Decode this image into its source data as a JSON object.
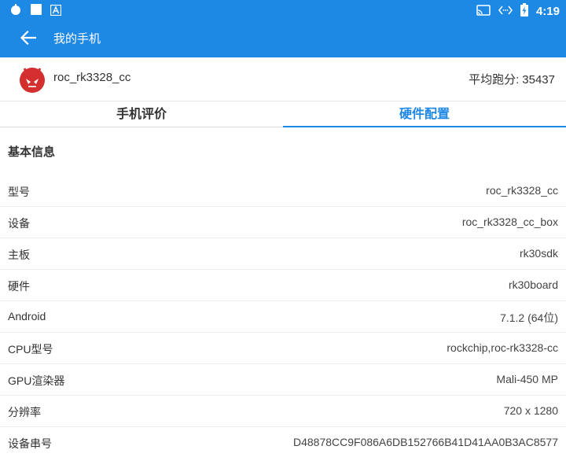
{
  "statusbar": {
    "time": "4:19"
  },
  "appbar": {
    "title": "我的手机"
  },
  "device": {
    "name": "roc_rk3328_cc",
    "score_label": "平均跑分:",
    "score_value": "35437"
  },
  "tabs": [
    {
      "label": "手机评价",
      "active": false
    },
    {
      "label": "硬件配置",
      "active": true
    }
  ],
  "section": {
    "title": "基本信息"
  },
  "info_rows": [
    {
      "label": "型号",
      "value": "roc_rk3328_cc"
    },
    {
      "label": "设备",
      "value": "roc_rk3328_cc_box"
    },
    {
      "label": "主板",
      "value": "rk30sdk"
    },
    {
      "label": "硬件",
      "value": "rk30board"
    },
    {
      "label": "Android",
      "value": "7.1.2 (64位)"
    },
    {
      "label": "CPU型号",
      "value": "rockchip,roc-rk3328-cc"
    },
    {
      "label": "GPU渲染器",
      "value": "Mali-450 MP"
    },
    {
      "label": "分辨率",
      "value": "720 x 1280"
    },
    {
      "label": "设备串号",
      "value": "D48878CC9F086A6DB152766B41D41AA0B3AC8577"
    }
  ],
  "colors": {
    "primary": "#1e88e5",
    "logo_red": "#d32f2f"
  }
}
